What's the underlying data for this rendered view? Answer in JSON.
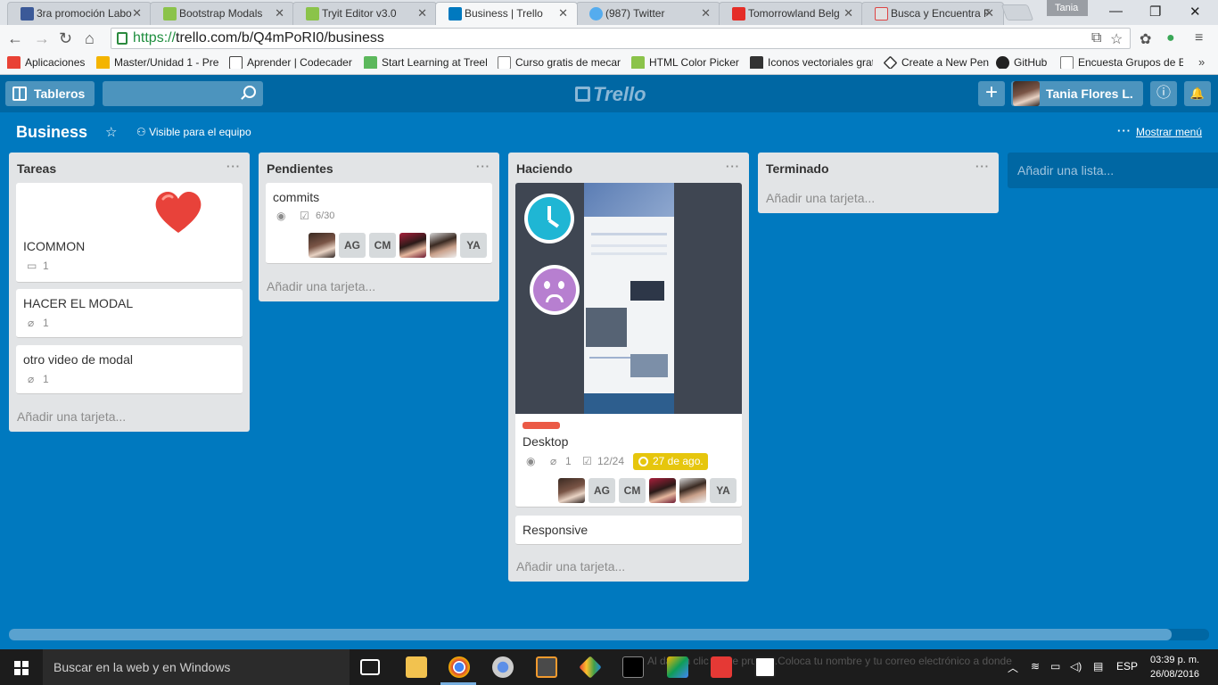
{
  "browser": {
    "tabs": [
      {
        "title": "3ra promoción Labo",
        "color": "#3b5998"
      },
      {
        "title": "Bootstrap Modals",
        "color": "#8bc34a"
      },
      {
        "title": "Tryit Editor v3.0",
        "color": "#8bc34a"
      },
      {
        "title": "Business | Trello",
        "color": "#0079bf"
      },
      {
        "title": "(987) Twitter",
        "color": "#55acee"
      },
      {
        "title": "Tomorrowland Belg",
        "color": "#e52d27"
      },
      {
        "title": "Busca y Encuentra F",
        "color": "#e0e0e0"
      }
    ],
    "user_chip": "Tania",
    "url_https": "https://",
    "url_rest": "trello.com/b/Q4mPoRI0/business",
    "bookmarks": [
      {
        "label": "Aplicaciones",
        "color": "#e94235"
      },
      {
        "label": "Master/Unidad 1 - Pre",
        "color": "#f4b400"
      },
      {
        "label": "Aprender | Codecader",
        "color": "#444444"
      },
      {
        "label": "Start Learning at Treeh",
        "color": "#5cb85c"
      },
      {
        "label": "Curso gratis de mecar",
        "color": "#ffffff"
      },
      {
        "label": "HTML Color Picker",
        "color": "#8bc34a"
      },
      {
        "label": "Iconos vectoriales grat",
        "color": "#333333"
      },
      {
        "label": "Create a New Pen",
        "color": "#333333"
      },
      {
        "label": "GitHub",
        "color": "#222222"
      },
      {
        "label": "Encuesta Grupos de E",
        "color": "#ffffff"
      }
    ]
  },
  "header": {
    "boards_label": "Tableros",
    "logo": "Trello",
    "add_label": "+",
    "user_name": "Tania Flores L.",
    "info_icon": "ⓘ",
    "bell_icon": "🔔"
  },
  "board": {
    "title": "Business",
    "visibility": "Visible para el equipo",
    "show_menu": "Mostrar menú",
    "menu_dots": "···"
  },
  "lists": {
    "tareas": {
      "title": "Tareas",
      "cards": [
        {
          "title": "ICOMMON",
          "comments": "1"
        },
        {
          "title": "HACER EL MODAL",
          "attachments": "1"
        },
        {
          "title": "otro video de modal",
          "attachments": "1"
        }
      ],
      "add": "Añadir una tarjeta..."
    },
    "pendientes": {
      "title": "Pendientes",
      "cards": [
        {
          "title": "commits",
          "checklist": "6/30",
          "members": [
            "AG",
            "CM",
            "YA"
          ]
        }
      ],
      "add": "Añadir una tarjeta..."
    },
    "haciendo": {
      "title": "Haciendo",
      "cards": [
        {
          "title": "Desktop",
          "attachments": "1",
          "checklist": "12/24",
          "due": "27 de ago.",
          "members": [
            "AG",
            "CM",
            "YA"
          ]
        },
        {
          "title": "Responsive"
        }
      ],
      "add": "Añadir una tarjeta..."
    },
    "terminado": {
      "title": "Terminado",
      "add": "Añadir una tarjeta..."
    }
  },
  "add_list": "Añadir una lista...",
  "dots": "···",
  "taskbar": {
    "search_placeholder": "Buscar en la web y en Windows",
    "ghost_text": "Al dar un clic sobre prueba.Coloca tu nombre y tu correo electrónico a donde",
    "lang": "ESP",
    "time": "03:39 p. m.",
    "date": "26/08/2016"
  }
}
